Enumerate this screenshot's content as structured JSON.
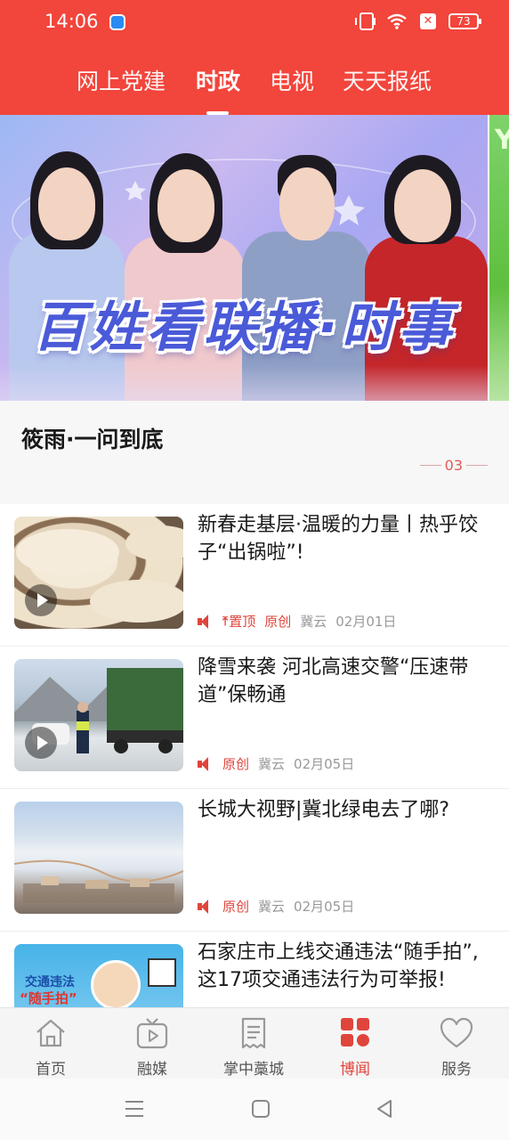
{
  "status_bar": {
    "time": "14:06",
    "battery": "73"
  },
  "tabs": [
    {
      "label": "网上党建",
      "active": false
    },
    {
      "label": "时政",
      "active": true
    },
    {
      "label": "电视",
      "active": false
    },
    {
      "label": "天天报纸",
      "active": false
    }
  ],
  "banner": {
    "title": "百姓看联播·时事",
    "caption": "筱雨·一问到底",
    "page": "03",
    "peek_text": "Y"
  },
  "news": [
    {
      "title": "新春走基层·温暖的力量丨热乎饺子“出锅啦”!",
      "pinned_label": "置顶",
      "tag": "原创",
      "source": "冀云",
      "date": "02月01日",
      "has_video": true
    },
    {
      "title": "降雪来袭 河北高速交警“压速带道”保畅通",
      "tag": "原创",
      "source": "冀云",
      "date": "02月05日",
      "has_video": true
    },
    {
      "title": "长城大视野|冀北绿电去了哪?",
      "tag": "原创",
      "source": "冀云",
      "date": "02月05日",
      "has_video": false
    },
    {
      "title": "石家庄市上线交通违法“随手拍”,这17项交通违法行为可举报!",
      "thumb_text_1": "交通违法",
      "thumb_text_2": "“随手拍”"
    }
  ],
  "bottom_nav": [
    {
      "label": "首页",
      "icon": "home-icon",
      "active": false
    },
    {
      "label": "融媒",
      "icon": "tv-play-icon",
      "active": false
    },
    {
      "label": "掌中藁城",
      "icon": "document-icon",
      "active": false
    },
    {
      "label": "博闻",
      "icon": "grid-icon",
      "active": true
    },
    {
      "label": "服务",
      "icon": "heart-icon",
      "active": false
    }
  ],
  "colors": {
    "brand_red": "#f2453b",
    "accent_red": "#e0453c"
  }
}
